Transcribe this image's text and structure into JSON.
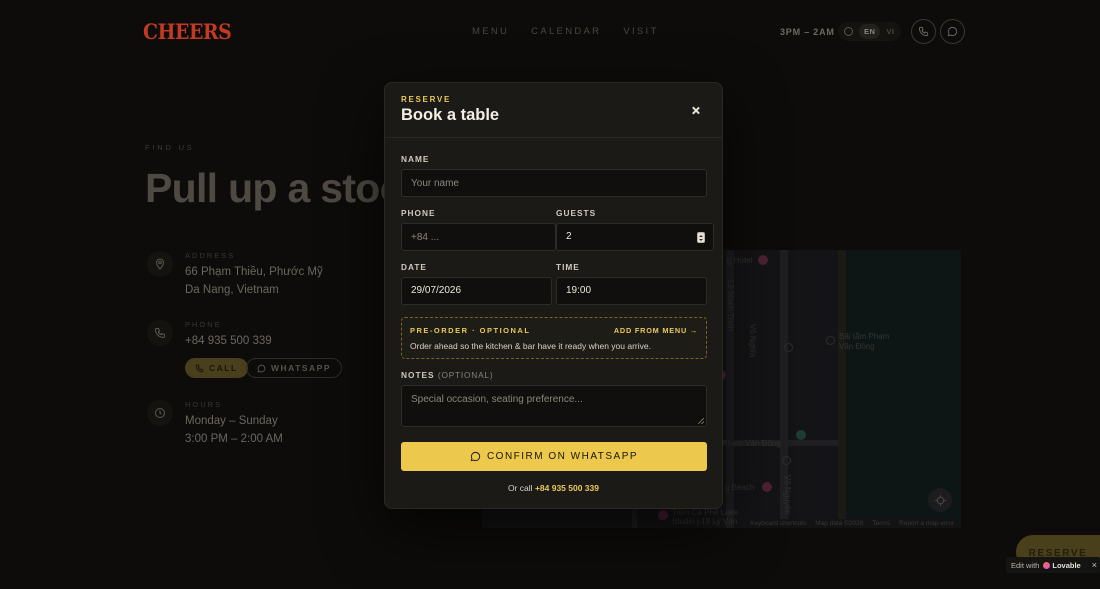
{
  "nav": {
    "logo": "CHEERS",
    "links": [
      "MENU",
      "CALENDAR",
      "VISIT"
    ],
    "hours": "3PM – 2AM",
    "lang": [
      "EN",
      "VI"
    ]
  },
  "hero": {
    "eyebrow": "FIND US",
    "title": "Pull up a stoo"
  },
  "info": {
    "address_label": "ADDRESS",
    "address_line1": "66 Phạm Thiều, Phước Mỹ",
    "address_line2": "Da Nang, Vietnam",
    "phone_label": "PHONE",
    "phone": "+84 935 500 339",
    "call_label": "CALL",
    "whatsapp_label": "WHATSAPP",
    "hours_label": "HOURS",
    "hours_days": "Monday – Sunday",
    "hours_time": "3:00 PM – 2:00 AM"
  },
  "map": {
    "labels": [
      "g Hotel",
      "Bãi tắm Phạm",
      "Văn Đồng",
      "Phạm Văn Đồng",
      "g Beach",
      "Tiệm Cà Phê Lake",
      "Studio | 19 Lý Vân"
    ],
    "vlabels": [
      "Lê Mạnh Trinh",
      "Võ Nghĩa",
      "Võ Nguyên"
    ],
    "attrib": [
      "Keyboard shortcuts",
      "Map data ©2026",
      "Terms",
      "Report a map error"
    ]
  },
  "fab": {
    "reserve": "RESERVE"
  },
  "lovable": {
    "prefix": "Edit with",
    "brand": "Lovable",
    "close": "×"
  },
  "modal": {
    "eyebrow": "RESERVE",
    "title": "Book a table",
    "name_label": "NAME",
    "name_placeholder": "Your name",
    "phone_label": "PHONE",
    "phone_placeholder": "+84 ...",
    "guests_label": "GUESTS",
    "guests_value": "2",
    "date_label": "DATE",
    "date_value": "29/07/2026",
    "time_label": "TIME",
    "time_value": "19:00",
    "preorder_title": "PRE-ORDER · OPTIONAL",
    "preorder_link": "ADD FROM MENU →",
    "preorder_desc": "Order ahead so the kitchen & bar have it ready when you arrive.",
    "notes_label": "NOTES",
    "notes_optional": "(OPTIONAL)",
    "notes_placeholder": "Special occasion, seating preference...",
    "confirm_label": "CONFIRM ON WHATSAPP",
    "or_call_prefix": "Or call",
    "or_call_phone": "+84 935 500 339"
  },
  "colors": {
    "accent": "#ecc84d",
    "logo_red": "#c23a22",
    "modal_bg": "#1c1a17"
  }
}
